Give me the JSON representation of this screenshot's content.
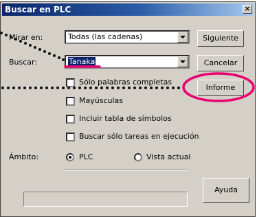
{
  "window": {
    "title": "Buscar en PLC",
    "close_glyph": "×"
  },
  "form": {
    "look_in_label": "Mirar en:",
    "look_in_value": "Todas (las cadenas)",
    "search_label": "Buscar:",
    "search_value": "Tanaka",
    "scope_label": "Ámbito:"
  },
  "options": [
    {
      "label": "Sólo palabras completas",
      "checked": false
    },
    {
      "label": "Mayúsculas",
      "checked": false
    },
    {
      "label": "Incluir tabla de símbolos",
      "checked": false
    },
    {
      "label": "Buscar sólo tareas en ejecución",
      "checked": false
    }
  ],
  "scope": [
    {
      "label": "PLC",
      "selected": true
    },
    {
      "label": "Vista actual",
      "selected": false
    }
  ],
  "buttons": {
    "next": "Siguiente",
    "cancel": "Cancelar",
    "report": "Informe",
    "help": "Ayuda"
  },
  "status_text": "",
  "colors": {
    "dialog_bg": "#d4d0c8",
    "title_bar": "#0a246a",
    "selection": "#0a246a",
    "annotation": "#e8006e"
  },
  "icons": {
    "close": "close-icon",
    "dropdown": "chevron-down-icon"
  }
}
